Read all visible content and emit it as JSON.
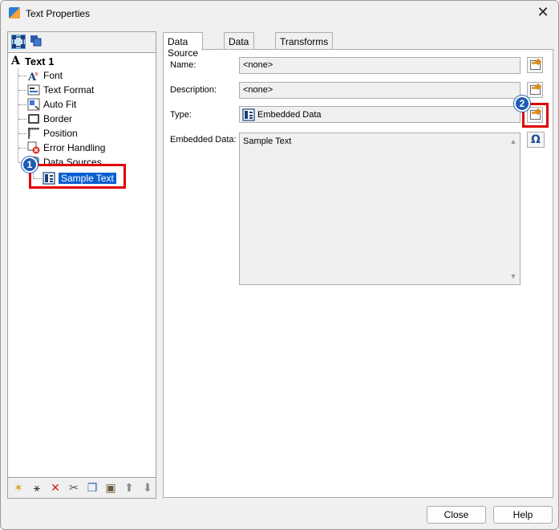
{
  "window": {
    "title": "Text Properties",
    "close_glyph": "✕"
  },
  "tree": {
    "root_label": "Text 1",
    "items": [
      {
        "label": "Font",
        "icon": "font-icon"
      },
      {
        "label": "Text Format",
        "icon": "text-format-icon"
      },
      {
        "label": "Auto Fit",
        "icon": "auto-fit-icon"
      },
      {
        "label": "Border",
        "icon": "border-icon"
      },
      {
        "label": "Position",
        "icon": "position-icon"
      },
      {
        "label": "Error Handling",
        "icon": "error-handling-icon"
      },
      {
        "label": "Data Sources",
        "icon": "data-sources-icon"
      }
    ],
    "selected_child": "Sample Text"
  },
  "tabs": [
    "Data Source",
    "Data Type",
    "Transforms"
  ],
  "active_tab": "Data Source",
  "form": {
    "name_label": "Name:",
    "name_value": "<none>",
    "description_label": "Description:",
    "description_value": "<none>",
    "type_label": "Type:",
    "type_value": "Embedded Data",
    "embedded_label": "Embedded Data:",
    "embedded_value": "Sample Text"
  },
  "scroll": {
    "up": "▲",
    "down": "▼"
  },
  "omega_label": "Ω",
  "buttons": {
    "close": "Close",
    "help": "Help"
  },
  "callouts": {
    "one": "1",
    "two": "2"
  },
  "colors": {
    "selection": "#0a5fd1",
    "callout": "#e10000",
    "badge": "#1e5bb5"
  }
}
